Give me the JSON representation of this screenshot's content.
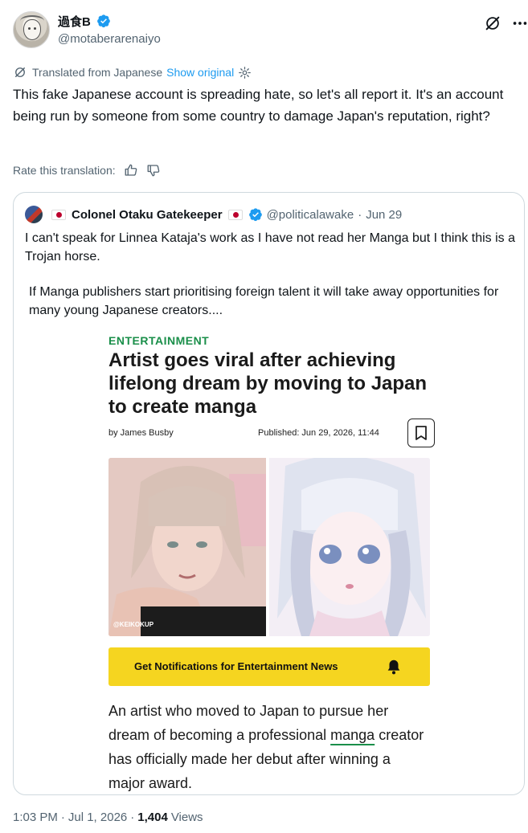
{
  "author": {
    "display_name": "過食B",
    "handle": "@motaberarenaiyo",
    "verified": true
  },
  "translation": {
    "label": "Translated from Japanese",
    "show_original": "Show original",
    "rate_label": "Rate this translation:"
  },
  "tweet": {
    "text": "This fake Japanese account is spreading hate, so let's all report it. It's an account being run by someone from some country to damage Japan's reputation, right?"
  },
  "quote": {
    "name": "Colonel Otaku Gatekeeper",
    "handle": "@politicalawake",
    "dot": "·",
    "date": "Jun 29",
    "paragraph1": "I can't speak for Linnea Kataja's work as I have not read her Manga but I think this is a Trojan horse.",
    "paragraph2": "If Manga publishers start prioritising foreign talent it will take away opportunities for many young Japanese creators...."
  },
  "article": {
    "category": "ENTERTAINMENT",
    "title": "Artist goes viral after achieving lifelong dream by moving to Japan to create manga",
    "byline": "by James Busby",
    "published": "Published: Jun 29, 2026, 11:44",
    "photo_caption": "@KEIKOKUP",
    "notification_button": "Get Notifications for Entertainment News",
    "body_before": "An artist who moved to Japan to pursue her dream of becoming a professional ",
    "body_link": "manga",
    "body_after": " creator has officially made her debut after winning a major award."
  },
  "meta": {
    "time": "1:03 PM",
    "date": "Jul 1, 2026",
    "views_count": "1,404",
    "views_label": "Views"
  },
  "colors": {
    "accent": "#1d9bf0",
    "text": "#0f1419",
    "muted": "#536471",
    "border": "#cfd9de",
    "category_green": "#1a8f4a",
    "notification_yellow": "#f5d520"
  }
}
